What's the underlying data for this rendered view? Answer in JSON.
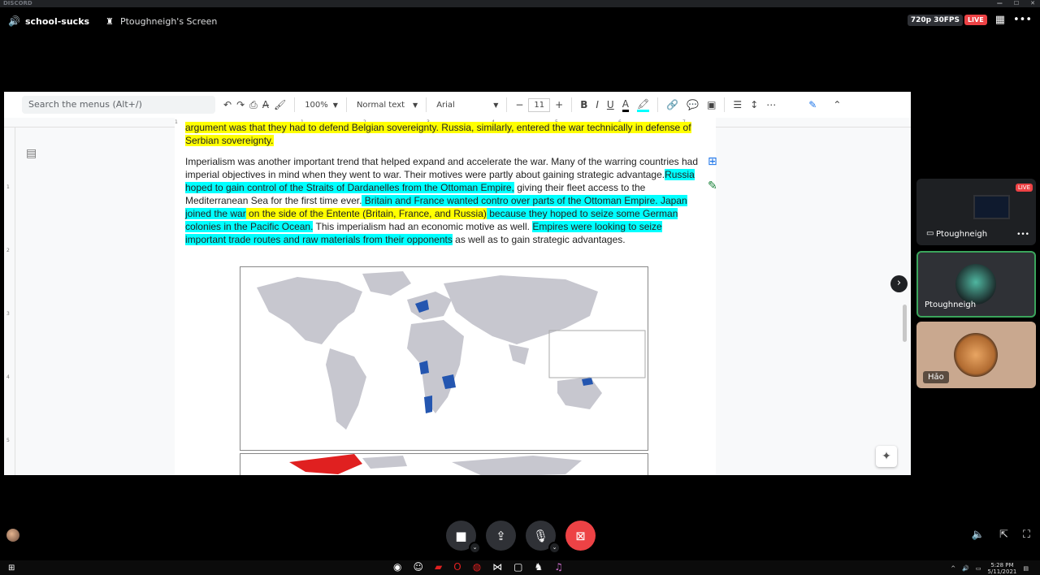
{
  "titlebar": {
    "app": "DISCORD",
    "controls": [
      "—",
      "☐",
      "✕"
    ]
  },
  "header": {
    "channel": "school-sucks",
    "screen_title": "Ptoughneigh's Screen",
    "quality": "720p 30FPS",
    "live": "LIVE"
  },
  "doc_toolbar": {
    "search_placeholder": "Search the menus (Alt+/)",
    "zoom": "100%",
    "style": "Normal text",
    "font": "Arial",
    "font_size": "11",
    "bold": "B",
    "italic": "I",
    "underline": "U",
    "text_color": "A"
  },
  "ruler": {
    "marks": [
      "1",
      "1",
      "2",
      "3",
      "4",
      "5",
      "6",
      "7"
    ]
  },
  "vruler": {
    "marks": [
      "1",
      "2",
      "3",
      "4",
      "5"
    ]
  },
  "document": {
    "top_cut": "argument was that they had to defend Belgian sovereignty. Russia, similarly, entered the war technically in defense of",
    "top_cut_2": "Serbian sovereignty.",
    "p_1": "Imperialism was another important trend that helped expand and accelerate the war. Many of the warring countries had imperial objectives in mind when they went to war. Their motives were partly about gaining strategic advantage.",
    "p_2": "Russia hoped to gain control of the Straits of Dardanelles from the Ottoman Empire,",
    "p_3": " giving their fleet access to the Mediterranean Sea for the first time ever.",
    "p_4": " Britain and France wanted contro        over parts of the Ottoman Empire. Japan joined the war",
    "p_5": " on the side of the Entente (Britain, France, and Russia)",
    "p_6": " because they hoped to seize some German colonies in the Pacific Ocean.",
    "p_7": " This imperialism had an economic motive as well. ",
    "p_8": "Empires were looking to seize important trade routes and raw materials from their opponents",
    "p_9": " as well as to gain strategic advantages."
  },
  "map": {
    "land_color": "#c7c7cf",
    "highlight_color": "#2456b0",
    "second_map_color": "#e02020"
  },
  "tiles": [
    {
      "name": "Ptoughneigh",
      "live": "LIVE",
      "more": "•••"
    },
    {
      "name": "Ptoughneigh"
    },
    {
      "name": "Hảo"
    }
  ],
  "taskbar": {
    "time": "5:28 PM",
    "date": "5/11/2021"
  },
  "colors": {
    "live_red": "#ed4245",
    "speaking_green": "#3ba55c",
    "highlight_yellow": "#ffff00",
    "highlight_cyan": "#00ffff"
  }
}
